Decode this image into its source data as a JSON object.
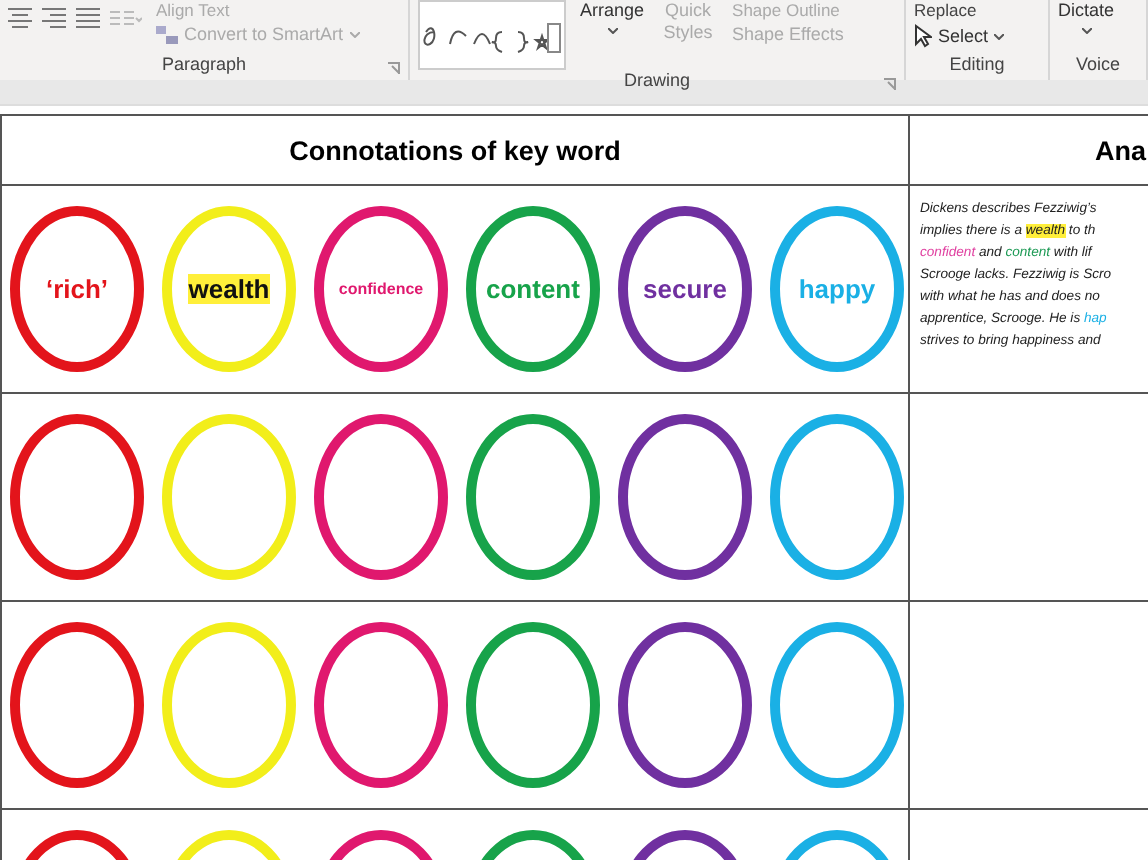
{
  "ribbon": {
    "groups": [
      {
        "kind": "paragraph",
        "label": "Paragraph",
        "top_text": "Align Text",
        "command": "Convert to SmartArt",
        "command_disabled": true
      },
      {
        "kind": "drawing",
        "label": "Drawing",
        "arrange": "Arrange",
        "quick_styles": "Quick Styles",
        "quick_styles_disabled": true,
        "top_text": "Shape Outline",
        "effects": "Shape Effects",
        "effects_disabled": true
      },
      {
        "kind": "editing",
        "label": "Editing",
        "top_text": "Replace",
        "command": "Select"
      },
      {
        "kind": "voice",
        "label": "Voice",
        "command": "Dictate"
      }
    ]
  },
  "table": {
    "columns": [
      "Connotations of key word",
      "Ana"
    ],
    "rows": [
      {
        "circles": [
          {
            "color": "#e3141b",
            "label": "‘rich’",
            "kind": "normal",
            "highlighted": false
          },
          {
            "color": "#f2ee1a",
            "label": "wealth",
            "kind": "normal",
            "highlighted": true
          },
          {
            "color": "#e0186e",
            "label": "confidence",
            "kind": "small",
            "highlighted": false
          },
          {
            "color": "#17a34a",
            "label": "content",
            "kind": "normal",
            "highlighted": false
          },
          {
            "color": "#7030a0",
            "label": "secure",
            "kind": "normal",
            "highlighted": false
          },
          {
            "color": "#1ab0e5",
            "label": "happy",
            "kind": "normal",
            "highlighted": false
          }
        ],
        "analysis": [
          [
            {
              "text": "Dickens describes Fezziwig’s"
            }
          ],
          [
            {
              "text": "implies there is a "
            },
            {
              "text": "wealth",
              "highlighted": true
            },
            {
              "text": " to th"
            }
          ],
          [
            {
              "text": "confident",
              "color": "#e040a0"
            },
            {
              "text": " and "
            },
            {
              "text": "content",
              "color": "#1d9a55"
            },
            {
              "text": " with lif"
            }
          ],
          [
            {
              "text": "Scrooge lacks. Fezziwig is Scro"
            }
          ],
          [
            {
              "text": "with what he has  and does no"
            }
          ],
          [
            {
              "text": "apprentice, Scrooge. He is "
            },
            {
              "text": "hap",
              "color": "#1ab0e5"
            }
          ],
          [
            {
              "text": "strives to bring happiness and"
            }
          ]
        ]
      },
      {
        "circles": [
          {
            "color": "#e3141b"
          },
          {
            "color": "#f2ee1a"
          },
          {
            "color": "#e0186e"
          },
          {
            "color": "#17a34a"
          },
          {
            "color": "#7030a0"
          },
          {
            "color": "#1ab0e5"
          }
        ]
      },
      {
        "circles": [
          {
            "color": "#e3141b"
          },
          {
            "color": "#f2ee1a"
          },
          {
            "color": "#e0186e"
          },
          {
            "color": "#17a34a"
          },
          {
            "color": "#7030a0"
          },
          {
            "color": "#1ab0e5"
          }
        ]
      },
      {
        "circles": [
          {
            "color": "#e3141b"
          },
          {
            "color": "#f2ee1a"
          },
          {
            "color": "#e0186e"
          },
          {
            "color": "#17a34a"
          },
          {
            "color": "#7030a0"
          },
          {
            "color": "#1ab0e5"
          }
        ]
      }
    ]
  }
}
